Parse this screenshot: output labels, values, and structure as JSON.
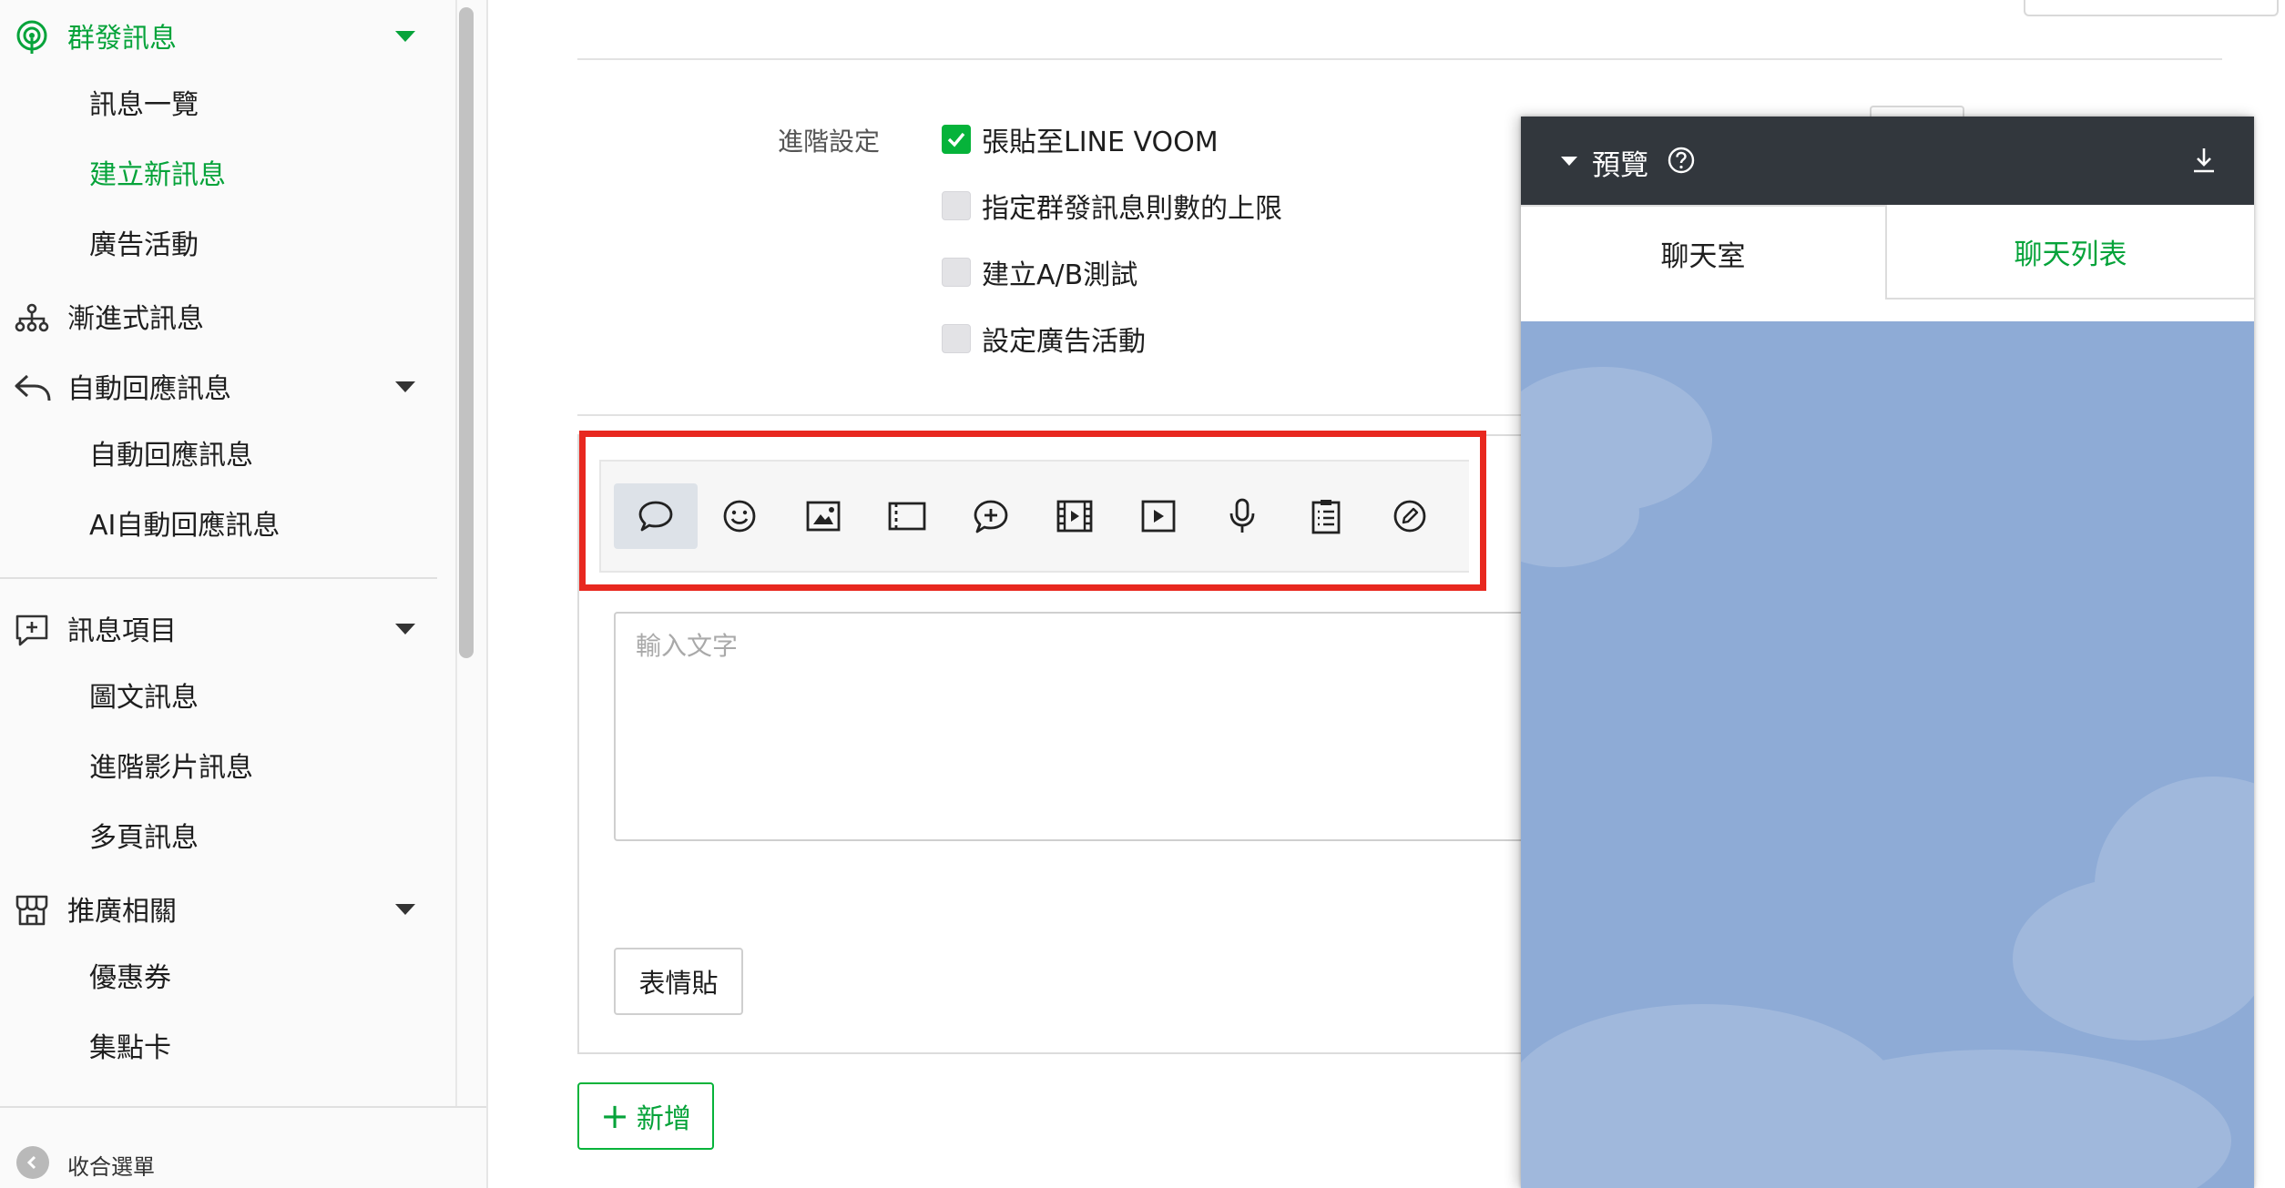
{
  "sidebar": {
    "groups": [
      {
        "label": "群發訊息",
        "icon": "broadcast-icon",
        "active": true,
        "expanded": true
      },
      {
        "label": "漸進式訊息",
        "icon": "hierarchy-icon"
      },
      {
        "label": "自動回應訊息",
        "icon": "reply-icon",
        "expanded": true
      },
      {
        "label": "訊息項目",
        "icon": "add-message-icon",
        "expanded": true
      },
      {
        "label": "推廣相關",
        "icon": "store-icon",
        "expanded": true
      }
    ],
    "sub_items": {
      "broadcast": [
        "訊息一覽",
        "建立新訊息",
        "廣告活動"
      ],
      "auto_reply": [
        "自動回應訊息",
        "AI自動回應訊息"
      ],
      "message_items": [
        "圖文訊息",
        "進階影片訊息",
        "多頁訊息"
      ],
      "promotion": [
        "優惠券",
        "集點卡"
      ]
    },
    "collapse_label": "收合選單"
  },
  "settings": {
    "advanced_label": "進階設定",
    "options": [
      {
        "label": "張貼至LINE VOOM",
        "checked": true
      },
      {
        "label": "指定群發訊息則數的上限",
        "checked": false
      },
      {
        "label": "建立A/B測試",
        "checked": false
      },
      {
        "label": "設定廣告活動",
        "checked": false
      }
    ]
  },
  "editor": {
    "toolbar_icons": [
      "text-bubble-icon",
      "emoji-icon",
      "image-icon",
      "coupon-icon",
      "rich-message-icon",
      "video-icon",
      "rich-video-icon",
      "voice-icon",
      "survey-icon",
      "edit-icon"
    ],
    "selected_tool": "text-bubble-icon",
    "text_placeholder": "輸入文字",
    "sticker_button": "表情貼",
    "add_button": "新增"
  },
  "preview": {
    "title": "預覽",
    "tabs": [
      "聊天室",
      "聊天列表"
    ],
    "active_tab": "聊天列表"
  },
  "colors": {
    "accent_green": "#06b33a",
    "highlight_red": "#e8281f",
    "preview_header": "#32373d",
    "chat_background": "#8eabd6"
  }
}
